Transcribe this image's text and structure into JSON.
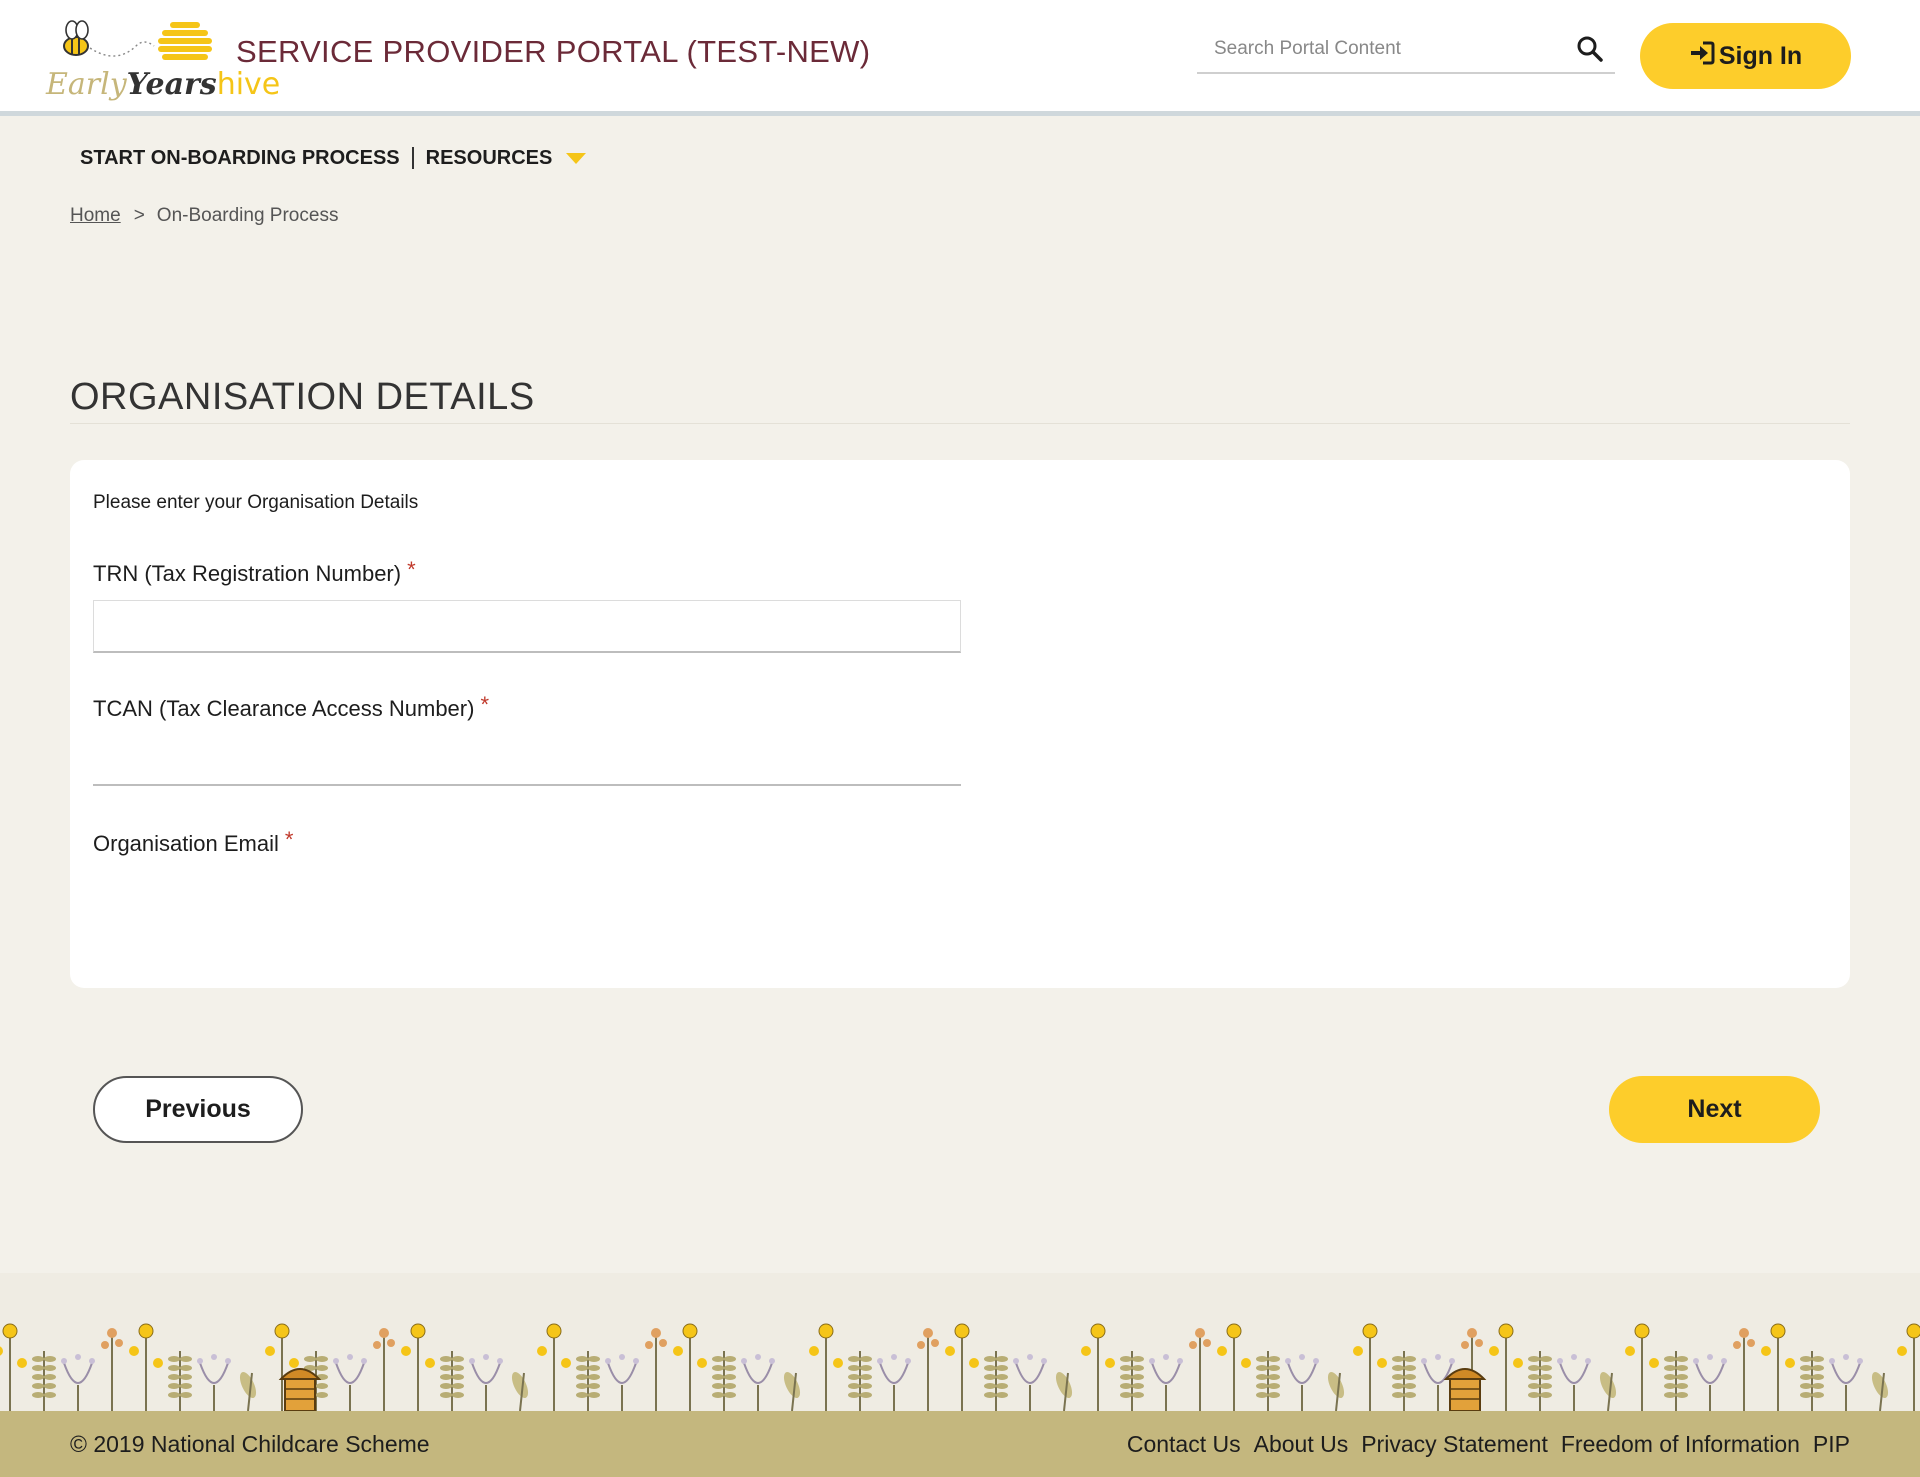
{
  "header": {
    "logo": {
      "word_early": "Early",
      "word_years": "Years",
      "word_hive": "hive"
    },
    "portal_title": "SERVICE PROVIDER PORTAL (TEST-NEW)",
    "search": {
      "placeholder": "Search Portal Content",
      "value": "",
      "icon": "search-icon"
    },
    "signin": {
      "label": "Sign In",
      "icon": "sign-in-icon"
    }
  },
  "nav": {
    "items": [
      {
        "label": "START ON-BOARDING PROCESS"
      },
      {
        "label": "RESOURCES",
        "has_dropdown": true
      }
    ]
  },
  "breadcrumb": {
    "home": "Home",
    "separator": ">",
    "current": "On-Boarding Process"
  },
  "section": {
    "title": "ORGANISATION DETAILS"
  },
  "form": {
    "intro": "Please enter your Organisation Details",
    "required_marker": "*",
    "fields": [
      {
        "label": "TRN (Tax Registration Number)",
        "value": "",
        "required": true
      },
      {
        "label": "TCAN (Tax Clearance Access Number)",
        "value": "",
        "required": true
      },
      {
        "label": "Organisation Email",
        "value": "",
        "required": true
      }
    ]
  },
  "buttons": {
    "previous": "Previous",
    "next": "Next"
  },
  "footer": {
    "copyright": "© 2019 National Childcare Scheme",
    "links": [
      "Contact Us",
      "About Us",
      "Privacy Statement",
      "Freedom of Information",
      "PIP"
    ]
  },
  "colors": {
    "accent_yellow": "#fdcd2b",
    "title_maroon": "#6b2a38",
    "page_bg": "#f3f1ea",
    "footer_bar": "#c4b77e",
    "required_red": "#c0392b"
  }
}
